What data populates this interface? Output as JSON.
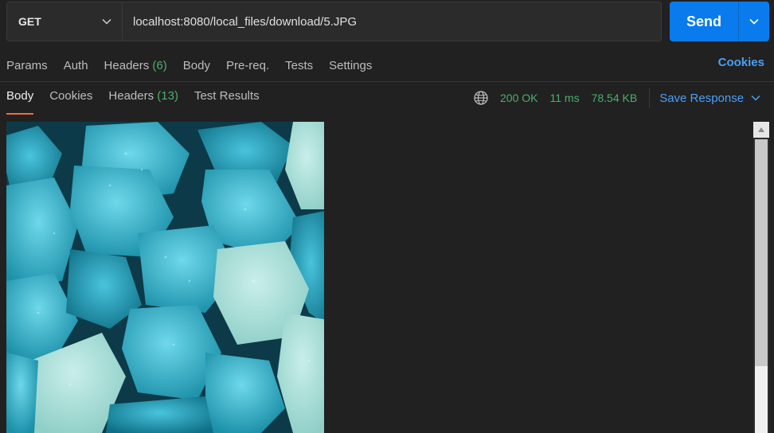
{
  "request": {
    "method": "GET",
    "url": "localhost:8080/local_files/download/5.JPG",
    "send_label": "Send"
  },
  "request_tabs": [
    {
      "label": "Params"
    },
    {
      "label": "Auth"
    },
    {
      "label": "Headers",
      "count": "(6)"
    },
    {
      "label": "Body"
    },
    {
      "label": "Pre-req."
    },
    {
      "label": "Tests"
    },
    {
      "label": "Settings"
    }
  ],
  "cookies_link": "Cookies",
  "response_tabs": [
    {
      "label": "Body",
      "active": true
    },
    {
      "label": "Cookies"
    },
    {
      "label": "Headers",
      "count": "(13)"
    },
    {
      "label": "Test Results"
    }
  ],
  "response_status": {
    "status": "200 OK",
    "time": "11 ms",
    "size": "78.54 KB",
    "save_label": "Save Response"
  },
  "colors": {
    "accent_blue": "#097bed",
    "link_blue": "#4a9ff5",
    "success_green": "#4caf6a",
    "active_tab_underline": "#f26b3a"
  },
  "icons": {
    "method_dropdown": "chevron-down-icon",
    "send_dropdown": "chevron-down-icon",
    "network": "globe-icon",
    "scroll_up": "triangle-up-icon"
  },
  "scrollbar": {
    "thumb_fraction": 0.75
  }
}
